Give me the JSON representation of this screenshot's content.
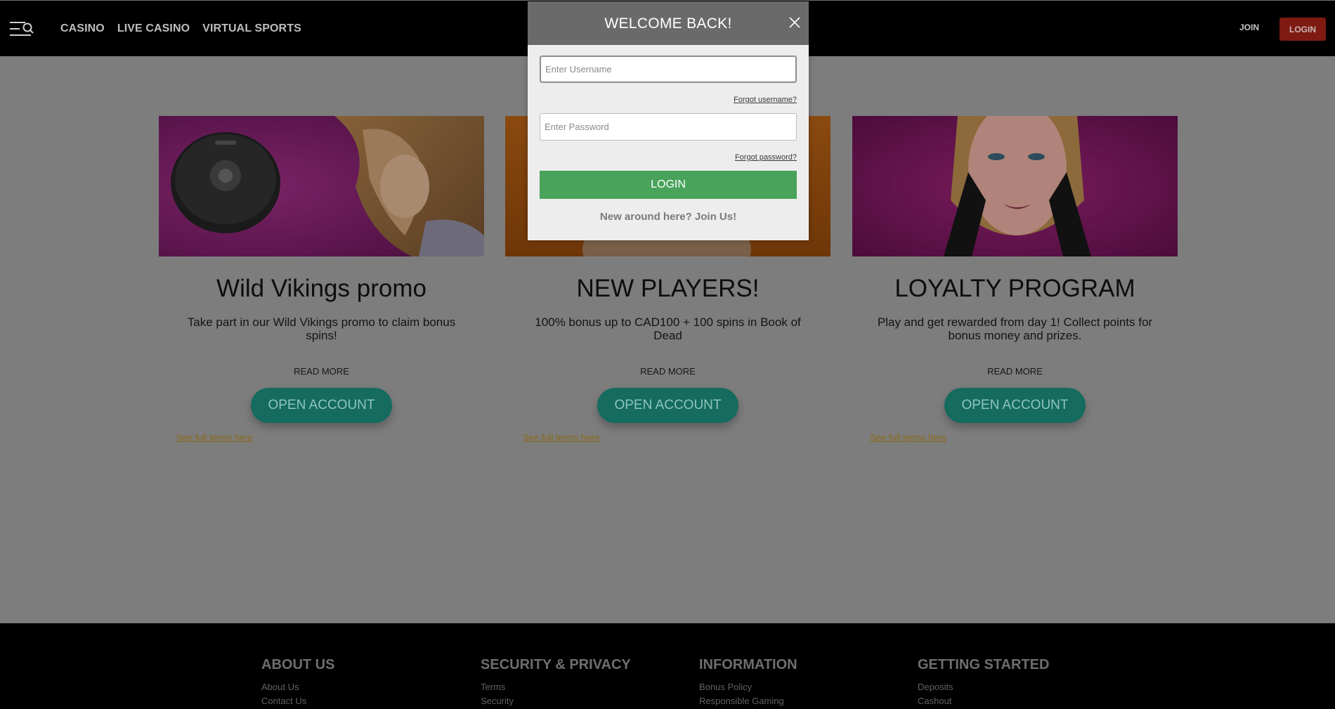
{
  "header": {
    "nav": [
      "CASINO",
      "LIVE CASINO",
      "VIRTUAL SPORTS"
    ],
    "join_label": "JOIN",
    "login_label": "LOGIN"
  },
  "cards": [
    {
      "title": "Wild Vikings promo",
      "description": "Take part in our Wild Vikings promo to claim bonus spins!",
      "read_more": "READ MORE",
      "cta": "OPEN ACCOUNT",
      "terms": "See full terms here"
    },
    {
      "title": "NEW PLAYERS!",
      "description": "100% bonus up to CAD100 + 100 spins in Book of Dead",
      "read_more": "READ MORE",
      "cta": "OPEN ACCOUNT",
      "terms": "See full terms here"
    },
    {
      "title": "LOYALTY PROGRAM",
      "description": "Play and get rewarded from day 1! Collect points for bonus money and prizes.",
      "read_more": "READ MORE",
      "cta": "OPEN ACCOUNT",
      "terms": "See full terms here"
    }
  ],
  "footer": {
    "columns": [
      {
        "title": "ABOUT US",
        "links": [
          "About Us",
          "Contact Us"
        ]
      },
      {
        "title": "SECURITY & PRIVACY",
        "links": [
          "Terms",
          "Security"
        ]
      },
      {
        "title": "INFORMATION",
        "links": [
          "Bonus Policy",
          "Responsible Gaming"
        ]
      },
      {
        "title": "GETTING STARTED",
        "links": [
          "Deposits",
          "Cashout"
        ]
      }
    ]
  },
  "modal": {
    "title": "WELCOME BACK!",
    "username_placeholder": "Enter Username",
    "forgot_username": "Forgot username?",
    "password_placeholder": "Enter Password",
    "forgot_password": "Forgot password?",
    "login_label": "LOGIN",
    "join_text": "New around here? Join Us!"
  },
  "colors": {
    "overlay_gray": "#7d7d7d",
    "header_bg": "#000000",
    "login_red": "#7e1a12",
    "cta_teal": "#146b5e",
    "modal_login_green": "#49a35b"
  },
  "icons": [
    "menu-search-icon",
    "close-icon"
  ]
}
